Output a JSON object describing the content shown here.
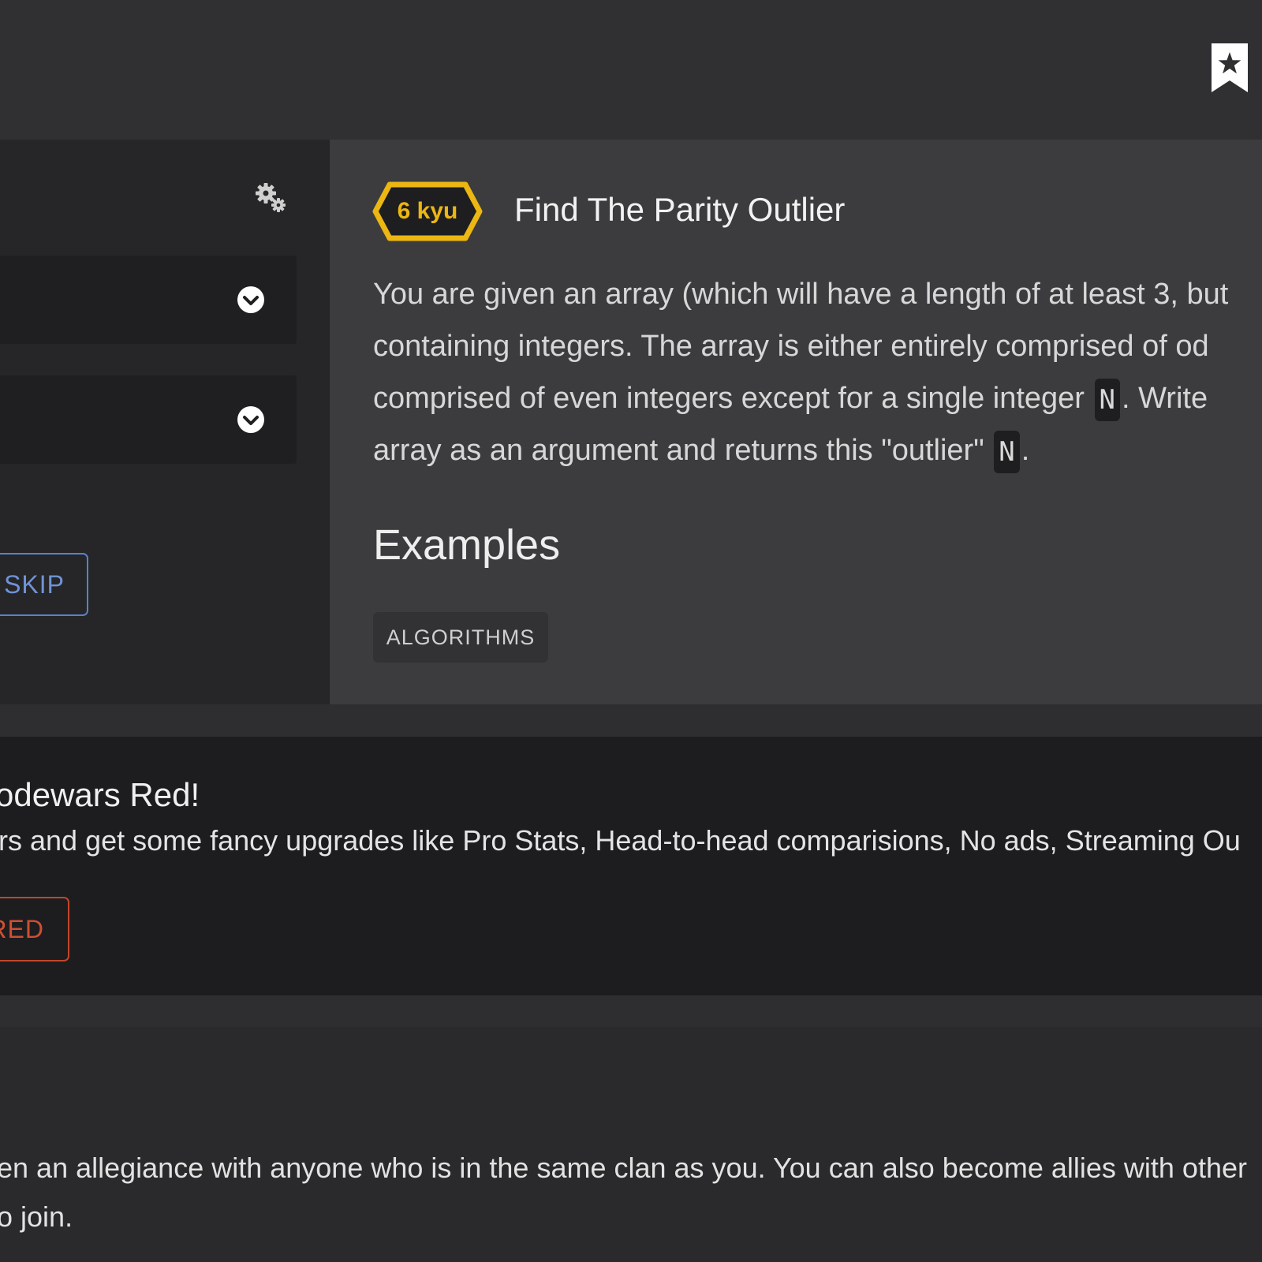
{
  "header": {
    "bookmark_icon": "bookmark-star-icon"
  },
  "sidebar": {
    "settings_icon": "gear-icon",
    "dropdowns": [
      {
        "icon": "chevron-down-icon"
      },
      {
        "icon": "chevron-down-icon"
      }
    ],
    "skip_label": "SKIP"
  },
  "kata": {
    "rank": "6 kyu",
    "title": "Find The Parity Outlier",
    "description": {
      "line1": "You are given an array (which will have a length of at least 3, but",
      "line2": "containing integers. The array is either entirely comprised of od",
      "line3_before": "comprised of even integers except for a single integer",
      "line3_code": "N",
      "line3_after": ". Write",
      "line4_before": "array as an argument and returns this \"outlier\"",
      "line4_code": "N",
      "line4_after": "."
    },
    "examples_heading": "Examples",
    "tag": "ALGORITHMS"
  },
  "promo": {
    "title": "odewars Red!",
    "text": "rs and get some fancy upgrades like Pro Stats, Head-to-head comparisions, No ads, Streaming Ou",
    "button_label": "RED"
  },
  "allies": {
    "line1": "en an allegiance with anyone who is in the same clan as you. You can also become allies with other",
    "line2": "o join."
  },
  "colors": {
    "rank_yellow": "#ecb613",
    "skip_blue": "#5a82c8",
    "red_accent": "#c2452c"
  }
}
